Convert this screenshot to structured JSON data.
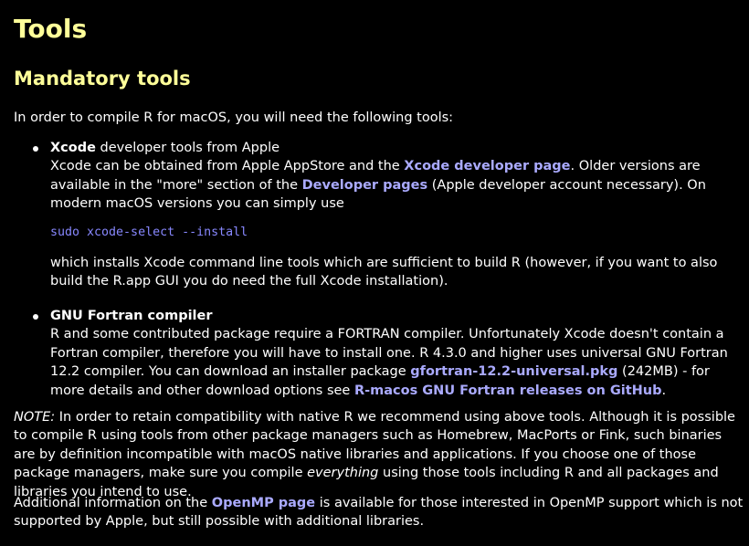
{
  "page_title": "Tools",
  "section_title": "Mandatory tools",
  "intro": "In order to compile R for macOS, you will need the following tools:",
  "xcode": {
    "term": "Xcode",
    "term_suffix": " developer tools from Apple",
    "text1": "Xcode can be obtained from Apple AppStore and the ",
    "link1": "Xcode developer page",
    "text2": ". Older versions are available in the \"more\" section of the ",
    "link2": "Developer pages",
    "text3": " (Apple developer account necessary). On modern macOS versions you can simply use",
    "code": "sudo xcode-select --install",
    "text4": "which installs Xcode command line tools which are sufficient to build R (however, if you want to also build the R.app GUI you do need the full Xcode installation)."
  },
  "fortran": {
    "term": "GNU Fortran compiler",
    "text1": "R and some contributed package require a FORTRAN compiler. Unfortunately Xcode doesn't contain a Fortran compiler, therefore you will have to install one. R 4.3.0 and higher uses universal GNU Fortran 12.2 compiler. You can download an installer package ",
    "link1": "gfortran-12.2-universal.pkg",
    "text2": " (242MB) - for more details and other download options see ",
    "link2": "R-macos GNU Fortran releases on GitHub",
    "text3": "."
  },
  "note": {
    "label": "NOTE:",
    "text1": " In order to retain compatibility with native R we recommend using above tools. Although it is possible to compile R using tools from other package managers such as Homebrew, MacPorts or Fink, such binaries are by definition incompatible with macOS native libraries and applications. If you choose one of those package managers, make sure you compile ",
    "emphasis": "everything",
    "text2": " using those tools including R and all packages and libraries you intend to use."
  },
  "extra": {
    "text1": "Additional information on the ",
    "link": "OpenMP page",
    "text2": " is available for those interested in OpenMP support which is not supported by Apple, but still possible with additional libraries."
  },
  "colors": {
    "background": "#000000",
    "heading": "#ffff99",
    "text": "#ffffff",
    "link": "#aaaaff",
    "code": "#8888ff"
  }
}
